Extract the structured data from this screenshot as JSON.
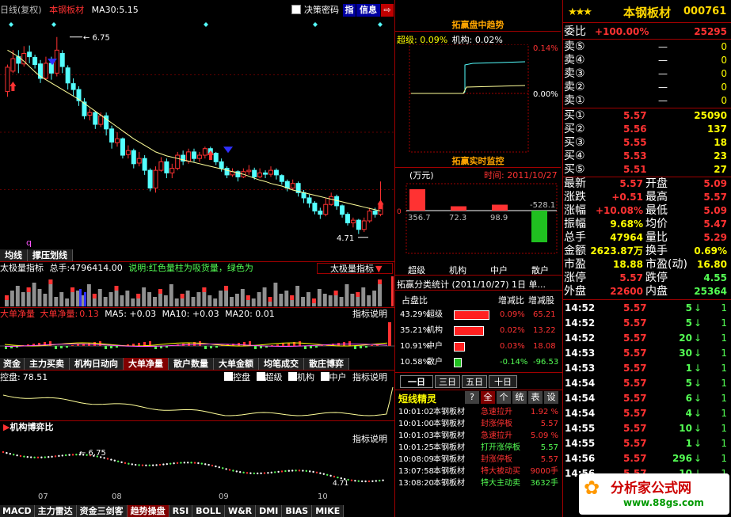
{
  "header": {
    "period": "日线(复权)",
    "stock_name": "本钢板材",
    "ma_label": "MA30:",
    "ma_value": "5.15",
    "decision_password": "决策密码",
    "btn_zhi": "指",
    "btn_info": "信息"
  },
  "main_chart": {
    "high_label": "6.75",
    "low_label": "4.71",
    "q_label": "q"
  },
  "candles": [
    {
      "o": 5.92,
      "c": 6.29,
      "h": 6.33,
      "l": 5.84
    },
    {
      "o": 6.23,
      "c": 6.42,
      "h": 6.55,
      "l": 6.2
    },
    {
      "o": 6.45,
      "c": 6.35,
      "h": 6.55,
      "l": 6.2
    },
    {
      "o": 6.34,
      "c": 6.5,
      "h": 6.61,
      "l": 6.3
    },
    {
      "o": 6.52,
      "c": 6.45,
      "h": 6.62,
      "l": 6.35
    },
    {
      "o": 6.44,
      "c": 6.33,
      "h": 6.48,
      "l": 6.27
    },
    {
      "o": 6.34,
      "c": 6.12,
      "h": 6.4,
      "l": 6.05
    },
    {
      "o": 6.12,
      "c": 6.35,
      "h": 6.45,
      "l": 6.1
    },
    {
      "o": 6.35,
      "c": 6.2,
      "h": 6.45,
      "l": 6.1
    },
    {
      "o": 6.2,
      "c": 6.55,
      "h": 6.75,
      "l": 6.15
    },
    {
      "o": 6.5,
      "c": 6.3,
      "h": 6.55,
      "l": 6.2
    },
    {
      "o": 6.28,
      "c": 6.05,
      "h": 6.32,
      "l": 5.95
    },
    {
      "o": 6.04,
      "c": 5.95,
      "h": 6.12,
      "l": 5.85
    },
    {
      "o": 5.95,
      "c": 5.78,
      "h": 6.0,
      "l": 5.7
    },
    {
      "o": 5.76,
      "c": 5.55,
      "h": 5.82,
      "l": 5.5
    },
    {
      "o": 5.56,
      "c": 5.6,
      "h": 5.66,
      "l": 5.48
    },
    {
      "o": 5.6,
      "c": 5.42,
      "h": 5.62,
      "l": 5.35
    },
    {
      "o": 5.42,
      "c": 5.55,
      "h": 5.6,
      "l": 5.38
    },
    {
      "o": 5.55,
      "c": 5.35,
      "h": 5.6,
      "l": 5.25
    },
    {
      "o": 5.35,
      "c": 5.15,
      "h": 5.4,
      "l": 5.05
    },
    {
      "o": 5.14,
      "c": 5.2,
      "h": 5.3,
      "l": 5.08
    },
    {
      "o": 5.2,
      "c": 4.95,
      "h": 5.22,
      "l": 4.9
    },
    {
      "o": 4.96,
      "c": 5.02,
      "h": 5.1,
      "l": 4.9
    },
    {
      "o": 5.02,
      "c": 4.82,
      "h": 5.05,
      "l": 4.75
    },
    {
      "o": 4.83,
      "c": 4.9,
      "h": 5.0,
      "l": 4.78
    },
    {
      "o": 4.9,
      "c": 4.72,
      "h": 4.95,
      "l": 4.65
    },
    {
      "o": 4.72,
      "c": 4.45,
      "h": 4.75,
      "l": 4.4
    },
    {
      "o": 4.45,
      "c": 4.72,
      "h": 4.78,
      "l": 4.38
    },
    {
      "o": 4.72,
      "c": 4.85,
      "h": 4.92,
      "l": 4.7
    },
    {
      "o": 4.85,
      "c": 4.68,
      "h": 4.9,
      "l": 4.6
    },
    {
      "o": 4.68,
      "c": 4.75,
      "h": 4.82,
      "l": 4.6
    },
    {
      "o": 4.75,
      "c": 4.95,
      "h": 5.0,
      "l": 4.72
    },
    {
      "o": 4.95,
      "c": 4.86,
      "h": 5.02,
      "l": 4.8
    },
    {
      "o": 4.86,
      "c": 5.0,
      "h": 5.05,
      "l": 4.82
    },
    {
      "o": 5.0,
      "c": 4.9,
      "h": 5.05,
      "l": 4.85
    },
    {
      "o": 4.9,
      "c": 4.95,
      "h": 5.0,
      "l": 4.85
    },
    {
      "o": 4.95,
      "c": 5.05,
      "h": 5.08,
      "l": 4.9
    },
    {
      "o": 5.05,
      "c": 4.98,
      "h": 5.08,
      "l": 4.9
    },
    {
      "o": 4.98,
      "c": 4.85,
      "h": 5.0,
      "l": 4.8
    },
    {
      "o": 4.85,
      "c": 4.75,
      "h": 4.9,
      "l": 4.7
    },
    {
      "o": 4.75,
      "c": 4.65,
      "h": 4.78,
      "l": 4.6
    },
    {
      "o": 4.65,
      "c": 4.7,
      "h": 4.75,
      "l": 4.62
    },
    {
      "o": 4.7,
      "c": 4.62,
      "h": 4.72,
      "l": 4.55
    },
    {
      "o": 4.62,
      "c": 4.7,
      "h": 4.75,
      "l": 4.6
    },
    {
      "o": 4.7,
      "c": 4.72,
      "h": 4.8,
      "l": 4.65
    },
    {
      "o": 4.72,
      "c": 4.62,
      "h": 4.76,
      "l": 4.58
    },
    {
      "o": 4.62,
      "c": 4.68,
      "h": 4.75,
      "l": 4.6
    },
    {
      "o": 4.68,
      "c": 4.66,
      "h": 4.72,
      "l": 4.6
    },
    {
      "o": 4.66,
      "c": 4.72,
      "h": 4.78,
      "l": 4.62
    },
    {
      "o": 4.72,
      "c": 4.65,
      "h": 4.75,
      "l": 4.58
    },
    {
      "o": 4.64,
      "c": 4.55,
      "h": 4.66,
      "l": 4.5
    },
    {
      "o": 4.55,
      "c": 4.45,
      "h": 4.58,
      "l": 4.4
    },
    {
      "o": 4.45,
      "c": 4.52,
      "h": 4.58,
      "l": 4.42
    },
    {
      "o": 4.52,
      "c": 4.38,
      "h": 4.55,
      "l": 4.32
    },
    {
      "o": 4.38,
      "c": 4.3,
      "h": 4.42,
      "l": 4.22
    },
    {
      "o": 4.3,
      "c": 4.22,
      "h": 4.35,
      "l": 4.15
    },
    {
      "o": 4.22,
      "c": 4.1,
      "h": 4.25,
      "l": 4.05
    },
    {
      "o": 4.1,
      "c": 4.05,
      "h": 4.15,
      "l": 3.98
    },
    {
      "o": 4.05,
      "c": 4.2,
      "h": 4.3,
      "l": 4.02
    },
    {
      "o": 4.2,
      "c": 4.32,
      "h": 4.38,
      "l": 4.18
    },
    {
      "o": 4.32,
      "c": 4.18,
      "h": 4.35,
      "l": 4.12
    },
    {
      "o": 4.18,
      "c": 4.05,
      "h": 4.2,
      "l": 4.0
    },
    {
      "o": 4.05,
      "c": 3.92,
      "h": 4.08,
      "l": 3.88
    },
    {
      "o": 3.92,
      "c": 3.96,
      "h": 4.0,
      "l": 3.85
    },
    {
      "o": 3.96,
      "c": 3.82,
      "h": 3.98,
      "l": 3.75
    },
    {
      "o": 3.82,
      "c": 3.95,
      "h": 4.0,
      "l": 3.78
    },
    {
      "o": 3.95,
      "c": 4.1,
      "h": 4.15,
      "l": 3.92
    },
    {
      "o": 4.1,
      "c": 4.05,
      "h": 4.15,
      "l": 4.0
    },
    {
      "o": 4.05,
      "c": 4.2,
      "h": 4.55,
      "l": 4.02
    }
  ],
  "ma30": [
    6.55,
    6.5,
    6.45,
    6.38,
    6.3,
    6.22,
    6.15,
    6.1,
    6.05,
    6.0,
    5.95,
    5.9,
    5.85,
    5.8,
    5.74,
    5.68,
    5.62,
    5.56,
    5.5,
    5.44,
    5.38,
    5.32,
    5.26,
    5.2,
    5.15,
    5.1,
    5.05,
    5.0,
    4.97,
    4.94,
    4.92,
    4.9,
    4.88,
    4.86,
    4.84,
    4.82,
    4.8,
    4.78,
    4.76,
    4.74,
    4.72,
    4.7,
    4.68,
    4.66,
    4.63,
    4.6,
    4.57,
    4.55,
    4.52,
    4.5,
    4.48,
    4.45,
    4.42,
    4.4,
    4.38,
    4.36,
    4.34,
    4.32,
    4.3,
    4.28,
    4.26,
    4.24,
    4.22,
    4.2,
    4.18,
    4.16,
    4.14,
    4.12,
    4.1
  ],
  "tabs1": [
    "均线",
    "撑压划线"
  ],
  "vol": {
    "title": "太极量指标",
    "total_label": "总手:",
    "total": "4796414.00",
    "desc": "说明:红色量柱为吸货量，绿色为",
    "indicator_sel": "太极量指标"
  },
  "bignet": {
    "title": "大单净量",
    "sub_label": "大单净量:",
    "val": "0.13",
    "ma5": "MA5: +0.03",
    "ma10": "MA10: +0.03",
    "ma20": "MA20: 0.01",
    "help": "指标说明"
  },
  "tabs2": [
    "资金",
    "主力买卖",
    "机构日动向",
    "大单净量",
    "散户数量",
    "大单金额",
    "均笔成交",
    "散庄博弈"
  ],
  "control": {
    "title": "控盘:",
    "val": "78.51",
    "opts": [
      "控盘",
      "超级",
      "机构",
      "中户"
    ],
    "help": "指标说明"
  },
  "inst": {
    "title": "机构博弈比",
    "help": "指标说明",
    "label": "6.75",
    "low": "4.71"
  },
  "months": [
    "07",
    "08",
    "09",
    "10"
  ],
  "tabs3": [
    "MACD",
    "主力雷达",
    "资金三剑客",
    "趋势操盘",
    "RSI",
    "BOLL",
    "W&R",
    "DMI",
    "BIAS",
    "MIKE"
  ],
  "trend": {
    "title": "拓赢盘中趋势",
    "super": "超级: 0.09%",
    "inst": "机构: 0.02%",
    "p1": "0.14%",
    "p2": "0.00%"
  },
  "monitor": {
    "title": "拓赢实时监控",
    "unit": "(万元)",
    "time": "时间: 2011/10/27",
    "values": [
      "356.7",
      "72.3",
      "98.9",
      "-528.1"
    ],
    "labels": [
      "超级",
      "机构",
      "中户",
      "散户"
    ]
  },
  "classify": {
    "title": "拓赢分类统计 (2011/10/27) 1日 单...",
    "head": [
      "占盘比",
      "增减比",
      "增减股"
    ],
    "rows": [
      {
        "pct": "43.29%",
        "name": "超级",
        "chg": "0.09%",
        "shares": "65.21"
      },
      {
        "pct": "35.21%",
        "name": "机构",
        "chg": "0.02%",
        "shares": "13.22"
      },
      {
        "pct": "10.91%",
        "name": "中户",
        "chg": "0.03%",
        "shares": "18.08"
      },
      {
        "pct": "10.58%",
        "name": "散户",
        "chg": "-0.14%",
        "shares": "-96.53"
      }
    ]
  },
  "periods": [
    "一日",
    "三日",
    "五日",
    "十日"
  ],
  "alerts": {
    "title": "短线精灵",
    "btns": [
      "?",
      "全",
      "个",
      "统",
      "表",
      "设"
    ],
    "rows": [
      {
        "t": "10:01:02",
        "n": "本钢板材",
        "e": "急速拉升",
        "v": "1.92 %"
      },
      {
        "t": "10:01:00",
        "n": "本钢板材",
        "e": "封涨停板",
        "v": "5.57"
      },
      {
        "t": "10:01:03",
        "n": "本钢板材",
        "e": "急速拉升",
        "v": "5.09 %"
      },
      {
        "t": "10:01:25",
        "n": "本钢板材",
        "e": "打开涨停板",
        "v": "5.57"
      },
      {
        "t": "10:08:09",
        "n": "本钢板材",
        "e": "封涨停板",
        "v": "5.57"
      },
      {
        "t": "13:07:58",
        "n": "本钢板材",
        "e": "特大被动买",
        "v": "9000手"
      },
      {
        "t": "13:08:20",
        "n": "本钢板材",
        "e": "特大主动卖",
        "v": "3632手"
      }
    ]
  },
  "quote": {
    "name": "本钢板材",
    "code": "000761",
    "ratio_label": "委比",
    "ratio": "+100.00%",
    "diff": "25295",
    "sells": [
      {
        "l": "卖⑤",
        "p": "—",
        "v": "0"
      },
      {
        "l": "卖④",
        "p": "—",
        "v": "0"
      },
      {
        "l": "卖③",
        "p": "—",
        "v": "0"
      },
      {
        "l": "卖②",
        "p": "—",
        "v": "0"
      },
      {
        "l": "卖①",
        "p": "—",
        "v": "0"
      }
    ],
    "buys": [
      {
        "l": "买①",
        "p": "5.57",
        "v": "25090"
      },
      {
        "l": "买②",
        "p": "5.56",
        "v": "137"
      },
      {
        "l": "买③",
        "p": "5.55",
        "v": "18"
      },
      {
        "l": "买④",
        "p": "5.53",
        "v": "23"
      },
      {
        "l": "买⑤",
        "p": "5.51",
        "v": "27"
      }
    ],
    "stats": [
      {
        "a": "最新",
        "av": "5.57",
        "ac": "red",
        "b": "开盘",
        "bv": "5.09",
        "bc": "red"
      },
      {
        "a": "涨跌",
        "av": "+0.51",
        "ac": "red",
        "b": "最高",
        "bv": "5.57",
        "bc": "red"
      },
      {
        "a": "涨幅",
        "av": "+10.08%",
        "ac": "red",
        "b": "最低",
        "bv": "5.09",
        "bc": "red"
      },
      {
        "a": "振幅",
        "av": "9.68%",
        "ac": "yel",
        "b": "均价",
        "bv": "5.47",
        "bc": "red"
      },
      {
        "a": "总手",
        "av": "47964",
        "ac": "yel",
        "b": "量比",
        "bv": "5.29",
        "bc": "red"
      },
      {
        "a": "金额",
        "av": "2623.87万",
        "ac": "yel",
        "b": "换手",
        "bv": "0.69%",
        "bc": "yel"
      },
      {
        "a": "市盈",
        "av": "18.88",
        "ac": "yel",
        "b": "市盈(动)",
        "bv": "16.80",
        "bc": "yel"
      },
      {
        "a": "涨停",
        "av": "5.57",
        "ac": "red",
        "b": "跌停",
        "bv": "4.55",
        "bc": "grn"
      },
      {
        "a": "外盘",
        "av": "22600",
        "ac": "red",
        "b": "内盘",
        "bv": "25364",
        "bc": "grn"
      }
    ]
  },
  "ticks": [
    {
      "t": "14:52",
      "p": "5.57",
      "v": "5",
      "s": "1"
    },
    {
      "t": "14:52",
      "p": "5.57",
      "v": "5",
      "s": "1"
    },
    {
      "t": "14:52",
      "p": "5.57",
      "v": "20",
      "s": "1"
    },
    {
      "t": "14:53",
      "p": "5.57",
      "v": "30",
      "s": "1"
    },
    {
      "t": "14:53",
      "p": "5.57",
      "v": "1",
      "s": "1"
    },
    {
      "t": "14:54",
      "p": "5.57",
      "v": "5",
      "s": "1"
    },
    {
      "t": "14:54",
      "p": "5.57",
      "v": "6",
      "s": "1"
    },
    {
      "t": "14:54",
      "p": "5.57",
      "v": "4",
      "s": "1"
    },
    {
      "t": "14:55",
      "p": "5.57",
      "v": "10",
      "s": "1"
    },
    {
      "t": "14:55",
      "p": "5.57",
      "v": "1",
      "s": "1"
    },
    {
      "t": "14:56",
      "p": "5.57",
      "v": "296",
      "s": "1"
    },
    {
      "t": "14:56",
      "p": "5.57",
      "v": "10",
      "s": "1"
    }
  ],
  "watermark": {
    "name": "分析家公式网",
    "url": "www.88gs.com"
  }
}
